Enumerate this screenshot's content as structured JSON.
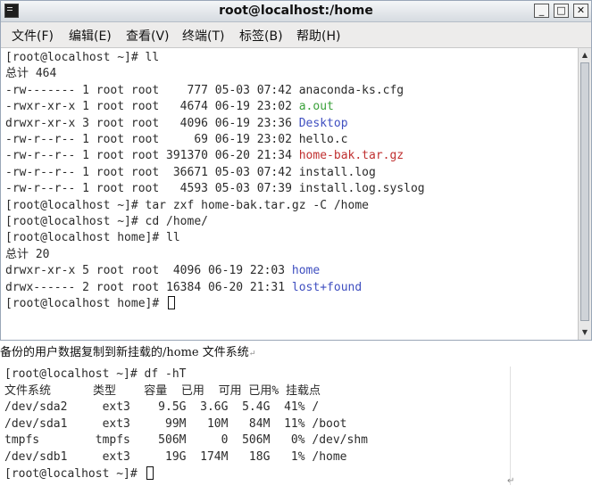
{
  "window": {
    "title": "root@localhost:/home",
    "minimize_glyph": "_",
    "maximize_glyph": "□",
    "close_glyph": "✕",
    "menu": [
      "文件(F)",
      "编辑(E)",
      "查看(V)",
      "终端(T)",
      "标签(B)",
      "帮助(H)"
    ]
  },
  "terminal": {
    "lines": [
      {
        "text": "[root@localhost ~]# ll",
        "color": "#2b2b2b"
      },
      {
        "text": "总计 464",
        "color": "#2b2b2b"
      },
      {
        "text": "-rw------- 1 root root    777 05-03 07:42 anaconda-ks.cfg",
        "color": "#2b2b2b"
      },
      {
        "text": "-rwxr-xr-x 1 root root   4674 06-19 23:02 ",
        "suffix": "a.out",
        "suffix_color": "#3aa13a"
      },
      {
        "text": "drwxr-xr-x 3 root root   4096 06-19 23:36 ",
        "suffix": "Desktop",
        "suffix_color": "#3f4fc0"
      },
      {
        "text": "-rw-r--r-- 1 root root     69 06-19 23:02 hello.c",
        "color": "#2b2b2b"
      },
      {
        "text": "-rw-r--r-- 1 root root 391370 06-20 21:34 ",
        "suffix": "home-bak.tar.gz",
        "suffix_color": "#c03030"
      },
      {
        "text": "-rw-r--r-- 1 root root  36671 05-03 07:42 install.log",
        "color": "#2b2b2b"
      },
      {
        "text": "-rw-r--r-- 1 root root   4593 05-03 07:39 install.log.syslog",
        "color": "#2b2b2b"
      },
      {
        "text": "[root@localhost ~]# tar zxf home-bak.tar.gz -C /home",
        "color": "#2b2b2b"
      },
      {
        "text": "[root@localhost ~]# cd /home/",
        "color": "#2b2b2b"
      },
      {
        "text": "[root@localhost home]# ll",
        "color": "#2b2b2b"
      },
      {
        "text": "总计 20",
        "color": "#2b2b2b"
      },
      {
        "text": "drwxr-xr-x 5 root root  4096 06-19 22:03 ",
        "suffix": "home",
        "suffix_color": "#3f4fc0"
      },
      {
        "text": "drwx------ 2 root root 16384 06-20 21:31 ",
        "suffix": "lost+found",
        "suffix_color": "#3f4fc0"
      },
      {
        "text": "[root@localhost home]# ",
        "cursor": true
      }
    ]
  },
  "caption": {
    "text": "备份的用户数据复制到新挂载的/home 文件系统",
    "mark": "↵"
  },
  "terminal2": {
    "lines": [
      {
        "text": "[root@localhost ~]# df -hT"
      },
      {
        "text": "文件系统      类型    容量  已用  可用 已用% 挂载点"
      },
      {
        "text": "/dev/sda2     ext3    9.5G  3.6G  5.4G  41% /"
      },
      {
        "text": "/dev/sda1     ext3     99M   10M   84M  11% /boot"
      },
      {
        "text": "tmpfs        tmpfs    506M     0  506M   0% /dev/shm"
      },
      {
        "text": "/dev/sdb1     ext3     19G  174M   18G   1% /home"
      },
      {
        "text": "[root@localhost ~]# ",
        "cursor": true
      }
    ],
    "end_mark": "↵"
  }
}
